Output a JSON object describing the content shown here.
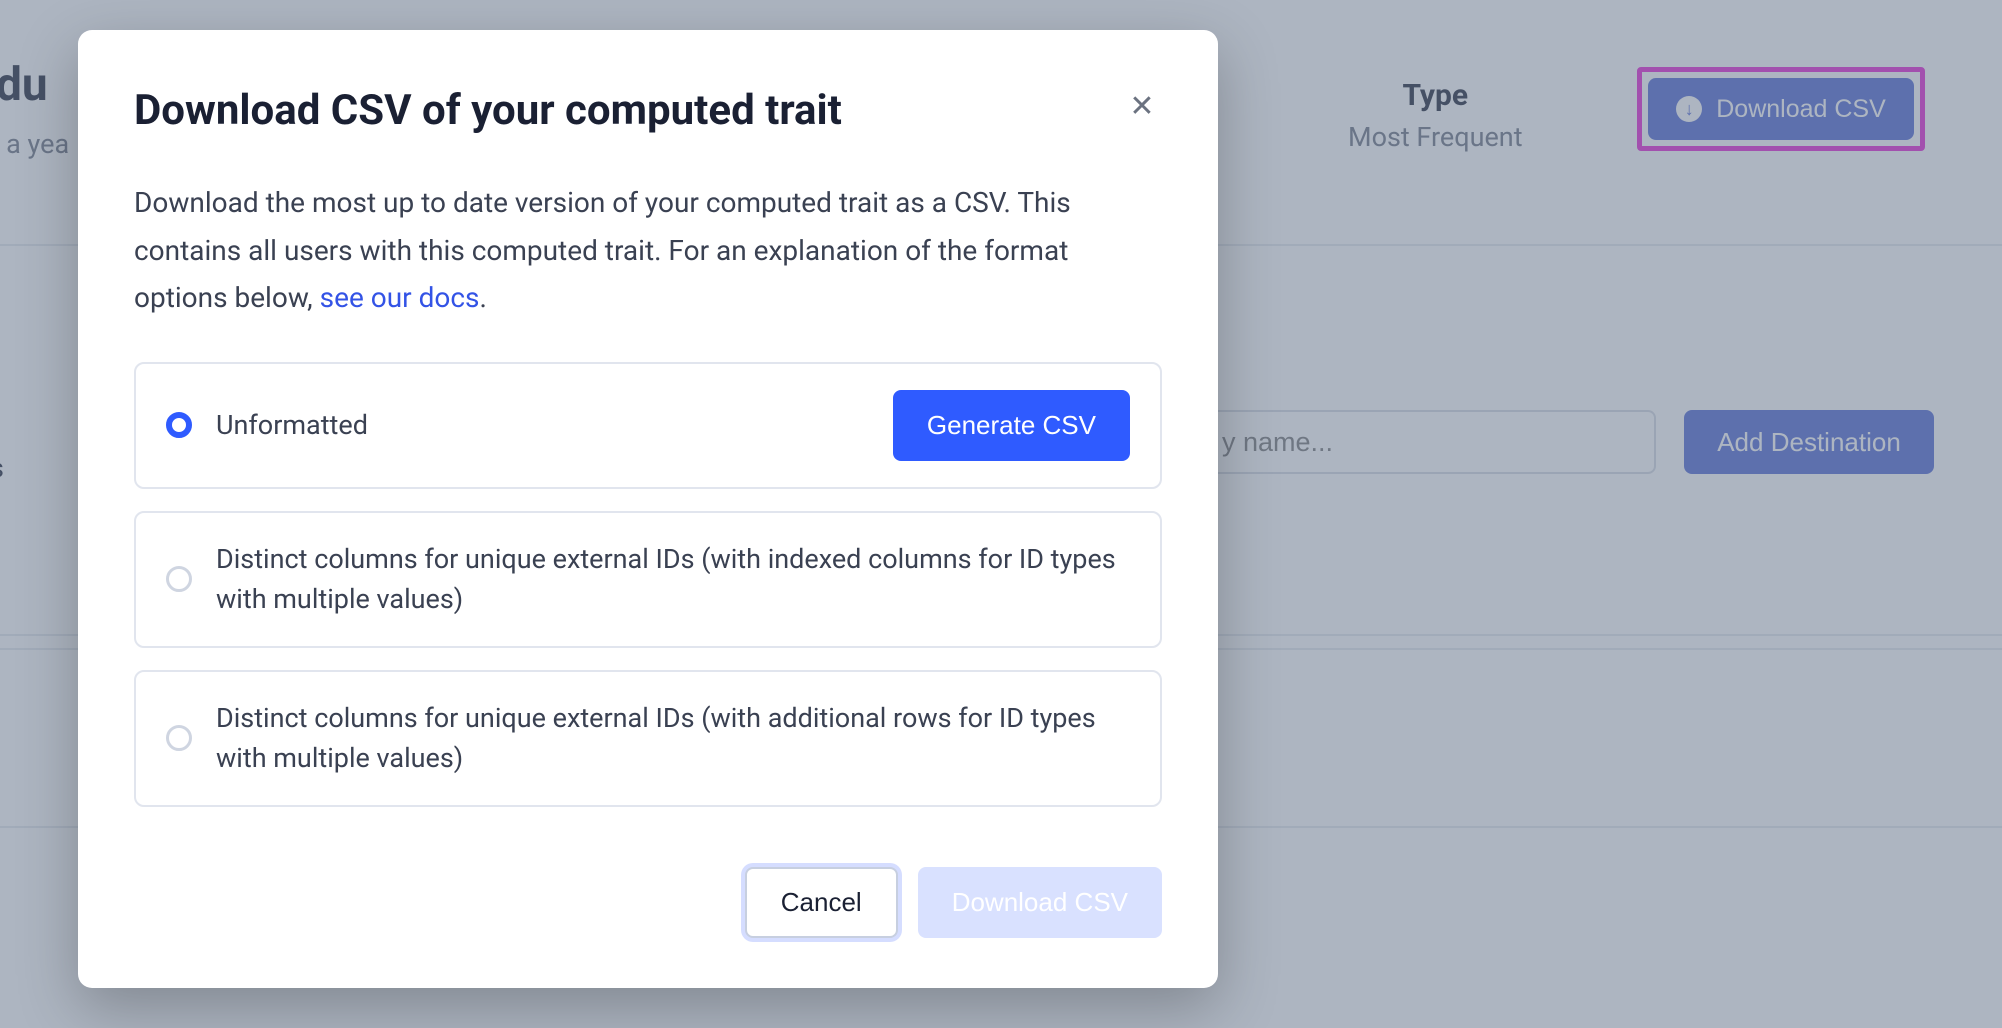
{
  "background": {
    "title_fragment": "odu",
    "subtitle_fragment": "ge a yea",
    "left_text_fragment": "s",
    "type_label": "Type",
    "type_value": "Most Frequent",
    "download_csv_label": "Download CSV",
    "search_placeholder": "y name...",
    "add_destination_label": "Add Destination"
  },
  "modal": {
    "title": "Download CSV of your computed trait",
    "description_pre": "Download the most up to date version of your computed trait as a CSV. This contains all users with this computed trait. For an explanation of the format options below, ",
    "description_link": "see our docs",
    "description_post": ".",
    "options": [
      {
        "label": "Unformatted",
        "selected": true
      },
      {
        "label": "Distinct columns for unique external IDs (with indexed columns for ID types with multiple values)",
        "selected": false
      },
      {
        "label": "Distinct columns for unique external IDs (with additional rows for ID types with multiple values)",
        "selected": false
      }
    ],
    "generate_label": "Generate CSV",
    "cancel_label": "Cancel",
    "download_label": "Download CSV"
  }
}
